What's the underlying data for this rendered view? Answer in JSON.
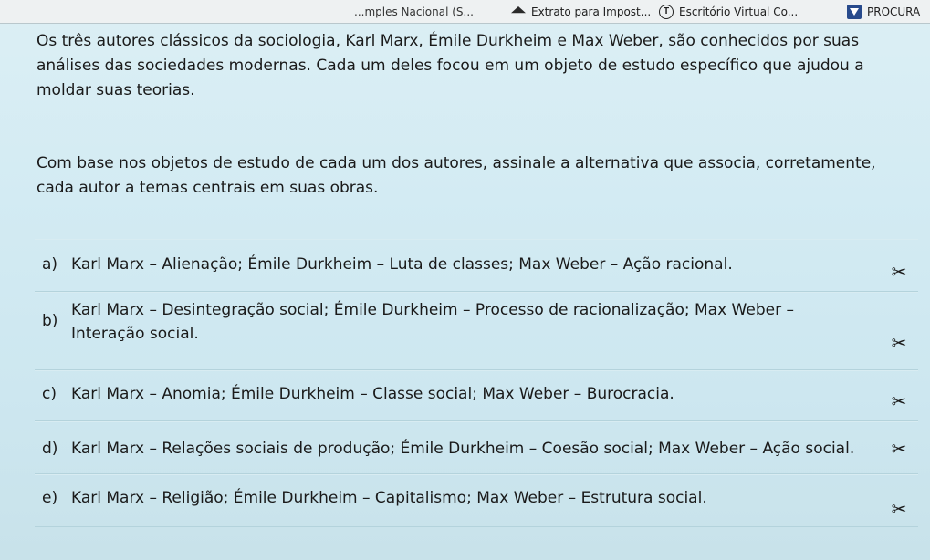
{
  "bookmarks": [
    {
      "label": "...mples Nacional (S...",
      "icon": "none"
    },
    {
      "label": "Extrato para Impost...",
      "icon": "pdf-file-icon"
    },
    {
      "label": "Escritório Virtual Co...",
      "icon": "t-circle-icon"
    },
    {
      "label": "PROCURA",
      "icon": "procuradoria-icon"
    }
  ],
  "question": {
    "paragraph1": "Os três autores clássicos da sociologia, Karl Marx, Émile Durkheim e Max Weber, são conhecidos por suas análises das sociedades modernas. Cada um deles focou em um objeto de estudo específico que ajudou a moldar suas teorias.",
    "paragraph2": "Com base nos objetos de estudo de cada um dos autores, assinale a alternativa que associa, corretamente, cada autor a temas centrais em suas obras."
  },
  "options": [
    {
      "letter": "a)",
      "text": "Karl Marx – Alienação; Émile Durkheim – Luta de classes; Max Weber – Ação racional.",
      "icon": "scissors-icon"
    },
    {
      "letter": "b)",
      "text": "Karl Marx – Desintegração social; Émile Durkheim – Processo de racionalização; Max Weber – Interação social.",
      "icon": "scissors-icon"
    },
    {
      "letter": "c)",
      "text": "Karl Marx – Anomia; Émile Durkheim – Classe social; Max Weber – Burocracia.",
      "icon": "scissors-icon"
    },
    {
      "letter": "d)",
      "text": "Karl Marx – Relações sociais de produção; Émile Durkheim – Coesão social; Max Weber – Ação social.",
      "icon": "scissors-icon"
    },
    {
      "letter": "e)",
      "text": "Karl Marx – Religião; Émile Durkheim – Capitalismo; Max Weber – Estrutura social.",
      "icon": "scissors-icon"
    }
  ]
}
